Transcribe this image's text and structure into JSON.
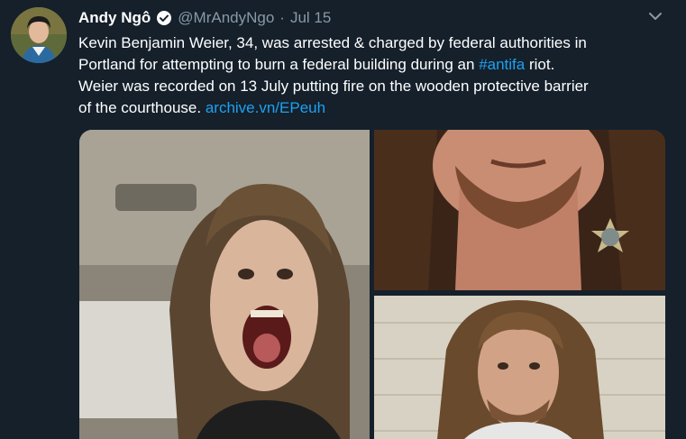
{
  "tweet": {
    "author_name": "Andy Ngô",
    "handle": "@MrAndyNgo",
    "separator": "·",
    "date": "Jul 15",
    "text_lines": [
      "Kevin Benjamin Weier, 34, was arrested & charged by federal authorities in",
      "Portland for attempting to burn a federal building during an ",
      "#antifa",
      " riot.",
      "Weier was recorded on 13 July putting fire on the wooden protective barrier",
      "of the courthouse. ",
      "archive.vn/EPeuh"
    ]
  },
  "colors": {
    "background": "#15202b",
    "text": "#ffffff",
    "muted": "#8899a6",
    "link": "#1da1f2",
    "verified": "#1da1f2"
  },
  "icons": {
    "verified": "verified-badge-icon",
    "caret": "chevron-down-icon"
  }
}
